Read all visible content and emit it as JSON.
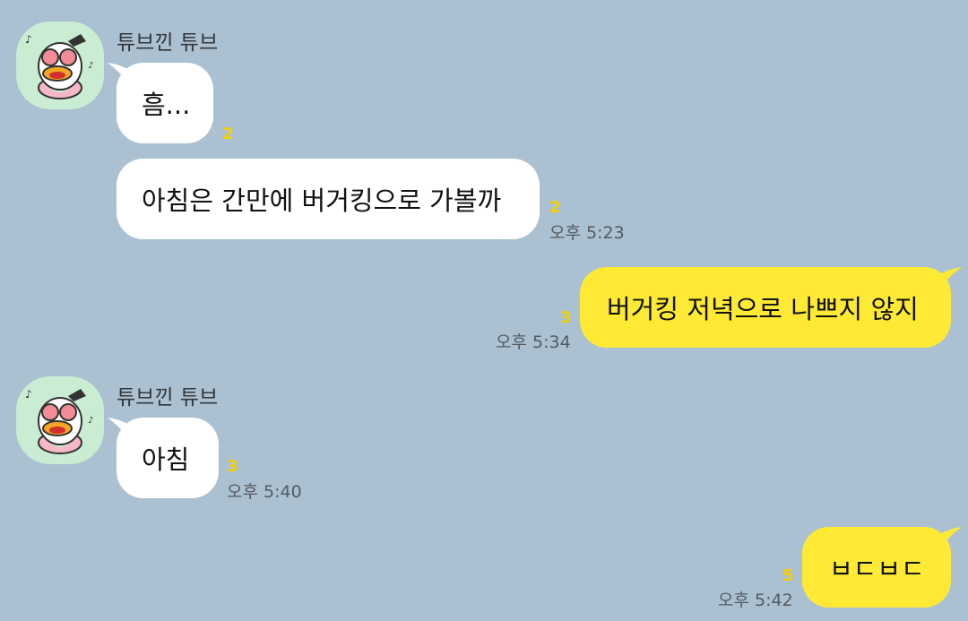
{
  "messages": [
    {
      "sender": "튜브낀 튜브",
      "text": "흠...",
      "unread": "2",
      "time": ""
    },
    {
      "text": "아침은 간만에 버거킹으로 가볼까",
      "unread": "2",
      "time": "오후 5:23"
    },
    {
      "text": "버거킹 저녁으로 나쁘지 않지",
      "unread": "3",
      "time": "오후 5:34"
    },
    {
      "sender": "튜브낀 튜브",
      "text": "아침",
      "unread": "3",
      "time": "오후 5:40"
    },
    {
      "text": "ㅂㄷㅂㄷ",
      "unread": "5",
      "time": "오후 5:42"
    }
  ],
  "colors": {
    "background": "#abc1d1",
    "incoming_bubble": "#ffffff",
    "outgoing_bubble": "#fee934",
    "unread": "#f5d000"
  },
  "avatar_icon": "duck-with-sunglasses-sticker-icon"
}
